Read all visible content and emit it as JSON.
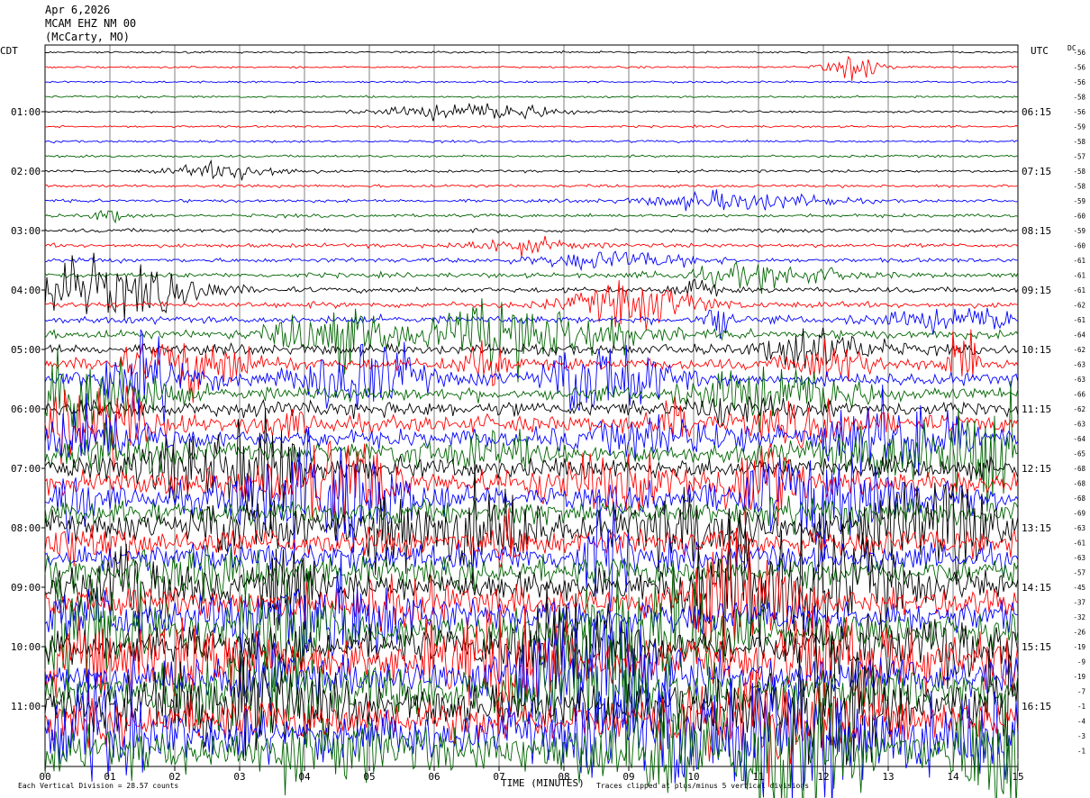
{
  "header": {
    "date": "Apr 6,2026",
    "station": "MCAM EHZ NM 00",
    "location": "(McCarty, MO)"
  },
  "left_axis_title": "CDT",
  "right_axis_title": "UTC",
  "dc_title": "DC",
  "x_axis_title": "TIME (MINUTES)",
  "footer": {
    "scale_note": "Each Vertical Division =   28.57 counts",
    "clip_note": "Traces clipped at plus/minus 5 vertical divisions"
  },
  "chart_data": {
    "type": "line",
    "title": "",
    "xlabel": "TIME (MINUTES)",
    "x_ticks": [
      "00",
      "01",
      "02",
      "03",
      "04",
      "05",
      "06",
      "07",
      "08",
      "09",
      "10",
      "11",
      "12",
      "13",
      "14",
      "15"
    ],
    "xlim": [
      0,
      15
    ],
    "rows_per_hour": 4,
    "row_count": 48,
    "left_time_labels": [
      "01:00",
      "02:00",
      "03:00",
      "04:00",
      "05:00",
      "06:00",
      "07:00",
      "08:00",
      "09:00",
      "10:00",
      "11:00"
    ],
    "right_time_labels": [
      "06:15",
      "07:15",
      "08:15",
      "09:15",
      "10:15",
      "11:15",
      "12:15",
      "13:15",
      "14:15",
      "15:15",
      "16:15"
    ],
    "time_label_rows": [
      4,
      8,
      12,
      16,
      20,
      24,
      28,
      32,
      36,
      40,
      44
    ],
    "trace_colors": [
      "#000000",
      "#ff0000",
      "#0000ff",
      "#006400"
    ],
    "dc_offsets": [
      -56,
      -56,
      -56,
      -58,
      -56,
      -59,
      -58,
      -57,
      -58,
      -58,
      -59,
      -60,
      -59,
      -60,
      -61,
      -61,
      -61,
      -62,
      -61,
      -64,
      -62,
      -63,
      -63,
      -66,
      -62,
      -63,
      -64,
      -65,
      -68,
      -68,
      -68,
      -69,
      -63,
      -61,
      -63,
      -57,
      -45,
      -37,
      -32,
      -26,
      -19,
      -9,
      -19,
      -7,
      -1,
      -4,
      -3,
      -1
    ],
    "grid": true
  }
}
